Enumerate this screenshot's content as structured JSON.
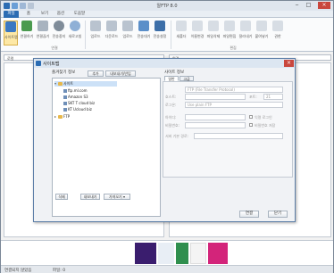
{
  "window": {
    "title": "알FTP 8.0"
  },
  "ribbon": {
    "tabs": [
      "파일",
      "홈",
      "보기",
      "옵션",
      "도움말"
    ],
    "buttons": [
      {
        "label": "사이트맵",
        "icon": "sitemap-icon"
      },
      {
        "label": "연결하기",
        "icon": "connect-icon"
      },
      {
        "label": "연결끊기",
        "icon": "disconnect-icon"
      },
      {
        "label": "전송중지",
        "icon": "stop-icon"
      },
      {
        "label": "새로고침",
        "icon": "refresh-icon"
      },
      {
        "label": "업로드",
        "icon": "upload-icon"
      },
      {
        "label": "다운로드",
        "icon": "download-icon"
      },
      {
        "label": "업로드",
        "icon": "upload-alt-icon"
      },
      {
        "label": "전송대기",
        "icon": "queue-icon"
      },
      {
        "label": "전송설정",
        "icon": "transfer-settings-icon"
      },
      {
        "label": "새폴더",
        "icon": "new-folder-icon"
      },
      {
        "label": "이름변경",
        "icon": "rename-icon"
      },
      {
        "label": "파일삭제",
        "icon": "delete-icon"
      },
      {
        "label": "파일편집",
        "icon": "edit-icon"
      },
      {
        "label": "잘라내기",
        "icon": "cut-icon"
      },
      {
        "label": "붙여넣기",
        "icon": "paste-icon"
      },
      {
        "label": "권한",
        "icon": "permission-icon"
      }
    ],
    "groups": [
      "연결",
      "편집"
    ]
  },
  "addressbar": {
    "local_label": "로컬",
    "remote_label": "원격"
  },
  "dialog": {
    "title": "사이트맵",
    "left_group": "즐겨찾기 정보",
    "add_btn": "추가",
    "import_btn": "내보내기/반입",
    "tree": [
      {
        "label": "사이트",
        "type": "folder"
      },
      {
        "label": "ftp.ml.com",
        "type": "site"
      },
      {
        "label": "Amazon S3",
        "type": "site"
      },
      {
        "label": "SKT T cloud biz",
        "type": "site"
      },
      {
        "label": "KT Ucloud biz",
        "type": "site"
      },
      {
        "label": "FTP",
        "type": "folder"
      }
    ],
    "bottom_btns": [
      "삭제",
      "내보내기",
      "가져오기 ▾"
    ],
    "right_group": "사이트 정보",
    "tabs": [
      "일반",
      "고급"
    ],
    "protocol": "FTP (File Transfer Protocol)",
    "host_label": "호스트:",
    "port_label": "포트:",
    "port_value": "21",
    "login_label": "로그온:",
    "login_type": "Use plain FTP",
    "user_label": "아이디:",
    "anon_label": "익명 로그인",
    "pass_label": "비밀번호:",
    "save_pass_label": "비밀번호 저장",
    "path_label": "서버 기본 경로:",
    "connect_btn": "연결",
    "close_btn": "닫기"
  },
  "status": {
    "left": "연결되지 않았음",
    "right": "파일: 0"
  },
  "colors": {
    "accent": "#2b6cb3",
    "close": "#c9473d"
  }
}
